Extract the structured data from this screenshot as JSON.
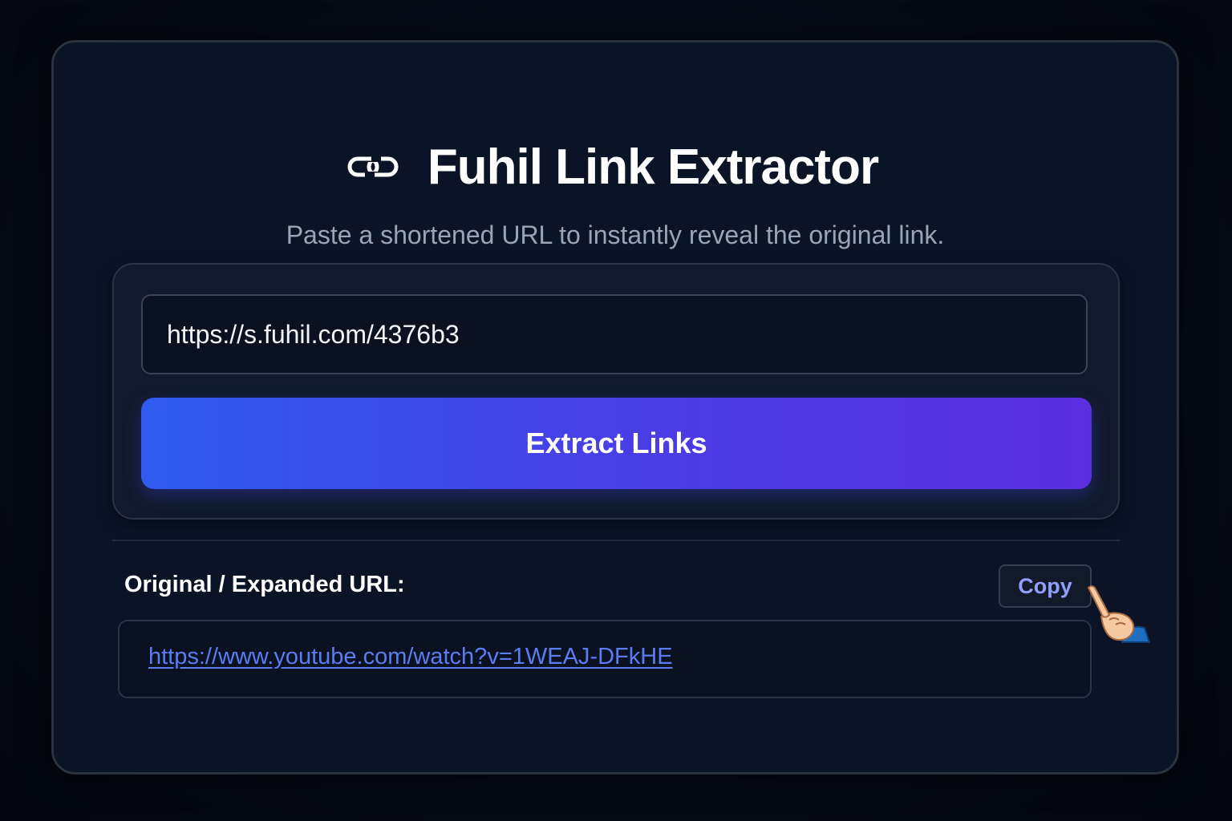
{
  "header": {
    "title": "Fuhil Link Extractor",
    "subtitle": "Paste a shortened URL to instantly reveal the original link.",
    "icon": "link-icon"
  },
  "form": {
    "url_value": "https://s.fuhil.com/4376b3",
    "extract_label": "Extract Links"
  },
  "result": {
    "label": "Original / Expanded URL:",
    "copy_label": "Copy",
    "expanded_url": "https://www.youtube.com/watch?v=1WEAJ-DFkHE",
    "cursor_icon": "pointing-hand-icon"
  },
  "colors": {
    "background": "#050a17",
    "card": "#0b1426",
    "button_gradient_start": "#2f5bf0",
    "button_gradient_end": "#5a2fe0",
    "link": "#5b7cf2",
    "copy_text": "#8f9ffb"
  }
}
